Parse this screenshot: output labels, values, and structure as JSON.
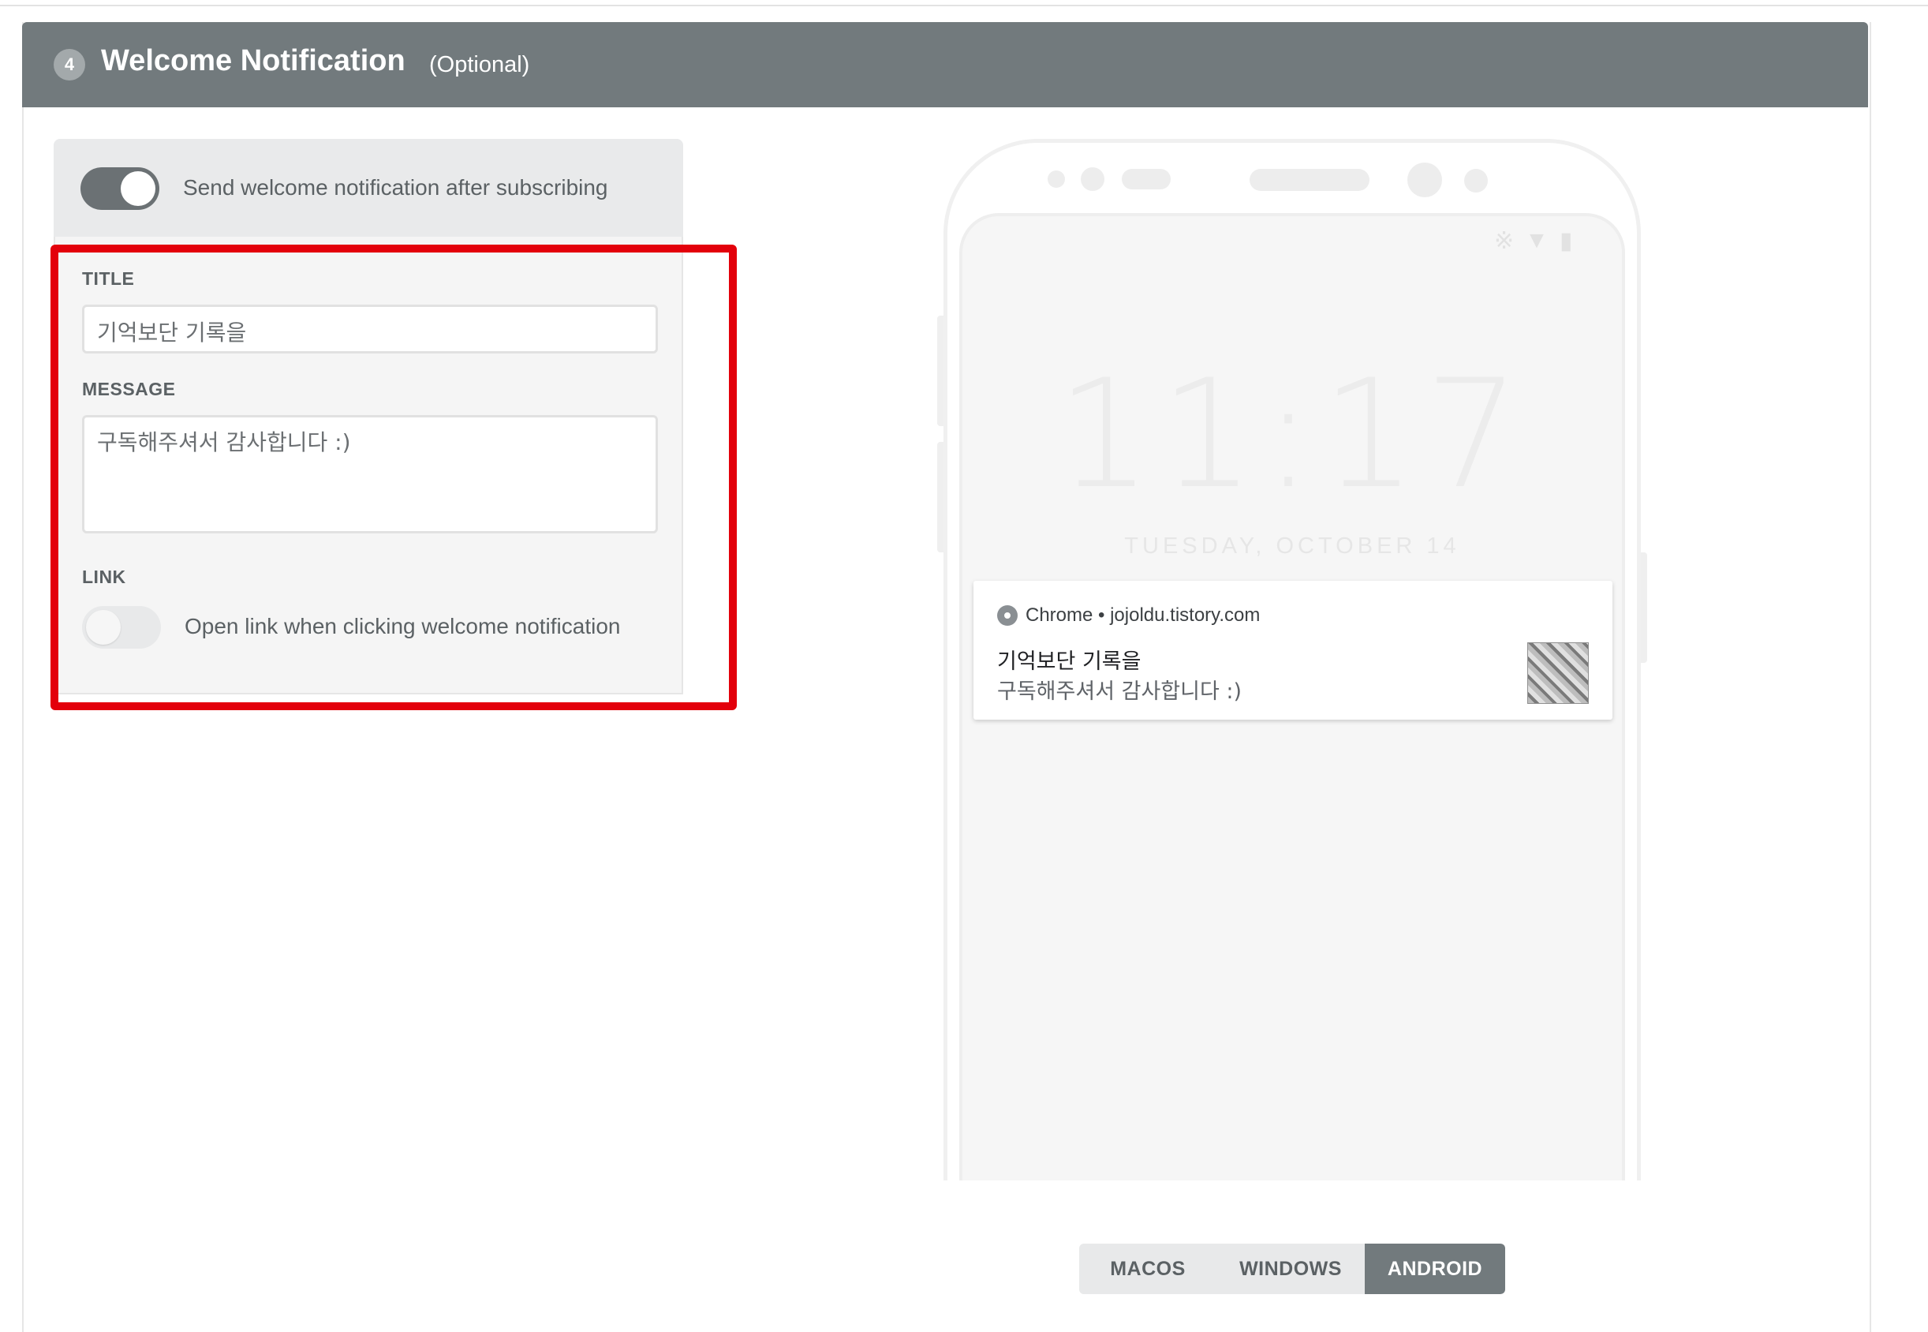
{
  "section": {
    "step_number": "4",
    "title": "Welcome Notification",
    "optional_label": "(Optional)"
  },
  "settings": {
    "enable_toggle": {
      "label": "Send welcome notification after subscribing",
      "checked": true
    },
    "title_field": {
      "label": "TITLE",
      "value": "기억보단 기록을"
    },
    "message_field": {
      "label": "MESSAGE",
      "value": "구독해주셔서 감사합니다 :)"
    },
    "link": {
      "label": "LINK",
      "toggle_label": "Open link when clicking welcome notification",
      "checked": false
    }
  },
  "preview": {
    "time": "11:17",
    "date": "TUESDAY, OCTOBER 14",
    "notification": {
      "app_line": "Chrome • jojoldu.tistory.com",
      "title": "기억보단 기록을",
      "body": "구독해주셔서 감사합니다 :)"
    },
    "status_icons": [
      "bluetooth-icon",
      "wifi-icon",
      "battery-icon"
    ]
  },
  "platform_tabs": {
    "items": [
      "MACOS",
      "WINDOWS",
      "ANDROID"
    ],
    "active": "ANDROID"
  },
  "colors": {
    "header_bg": "#727a7d",
    "highlight": "#e3000b",
    "toggle_on": "#6b7174"
  }
}
